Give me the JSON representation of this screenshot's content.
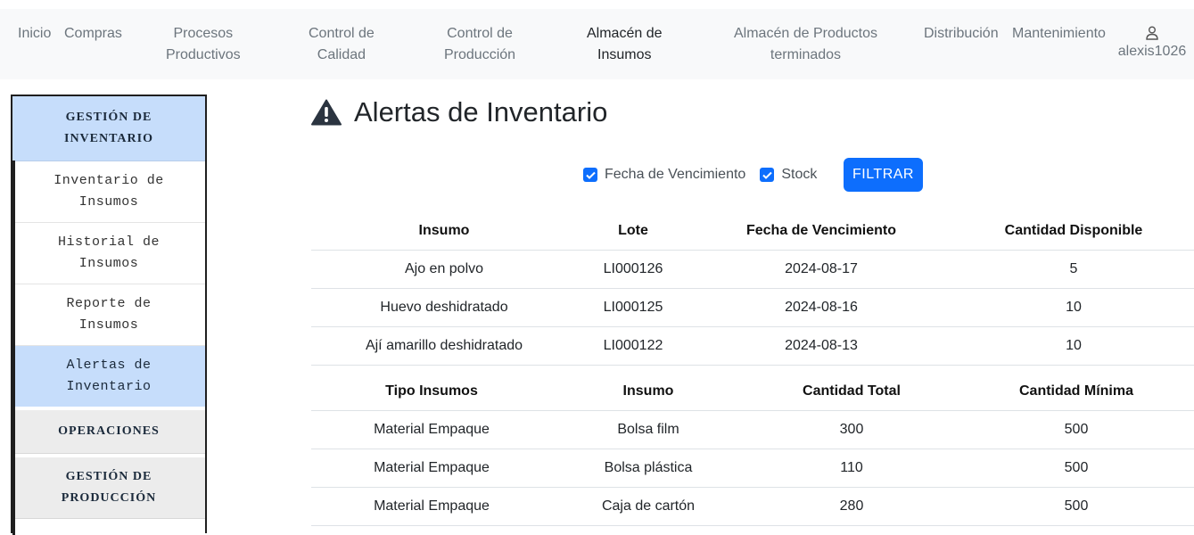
{
  "nav": {
    "items": [
      {
        "label_l1": "Inicio",
        "label_l2": ""
      },
      {
        "label_l1": "Compras",
        "label_l2": ""
      },
      {
        "label_l1": "Procesos",
        "label_l2": "Productivos"
      },
      {
        "label_l1": "Control de",
        "label_l2": "Calidad"
      },
      {
        "label_l1": "Control de",
        "label_l2": "Producción"
      },
      {
        "label_l1": "Almacén de",
        "label_l2": "Insumos"
      },
      {
        "label_l1": "Almacén de Productos",
        "label_l2": "terminados"
      },
      {
        "label_l1": "Distribución",
        "label_l2": ""
      },
      {
        "label_l1": "Mantenimiento",
        "label_l2": ""
      }
    ],
    "user": "alexis1026"
  },
  "sidebar": {
    "header_l1": "GESTIÓN DE",
    "header_l2": "INVENTARIO",
    "items": [
      {
        "l1": "Inventario de",
        "l2": "Insumos"
      },
      {
        "l1": "Historial de",
        "l2": "Insumos"
      },
      {
        "l1": "Reporte de",
        "l2": "Insumos"
      },
      {
        "l1": "Alertas de",
        "l2": "Inventario"
      }
    ],
    "section_operaciones": "OPERACIONES",
    "section_gestion_l1": "GESTIÓN DE",
    "section_gestion_l2": "PRODUCCIÓN"
  },
  "main": {
    "title": "Alertas de Inventario",
    "filters": {
      "fecha_label": "Fecha de Vencimiento",
      "stock_label": "Stock",
      "button_label": "FILTRAR"
    },
    "expiry_table": {
      "headers": [
        "Insumo",
        "Lote",
        "Fecha de Vencimiento",
        "Cantidad Disponible"
      ],
      "rows": [
        [
          "Ajo en polvo",
          "LI000126",
          "2024-08-17",
          "5"
        ],
        [
          "Huevo deshidratado",
          "LI000125",
          "2024-08-16",
          "10"
        ],
        [
          "Ají amarillo deshidratado",
          "LI000122",
          "2024-08-13",
          "10"
        ]
      ]
    },
    "stock_table": {
      "headers": [
        "Tipo Insumos",
        "Insumo",
        "Cantidad Total",
        "Cantidad Mínima"
      ],
      "rows": [
        [
          "Material Empaque",
          "Bolsa film",
          "300",
          "500"
        ],
        [
          "Material Empaque",
          "Bolsa plástica",
          "110",
          "500"
        ],
        [
          "Material Empaque",
          "Caja de cartón",
          "280",
          "500"
        ]
      ]
    }
  },
  "colors": {
    "primary": "#0d6efd",
    "sidebar_active": "#c6ddfb",
    "nav_bg": "#f8f9fa"
  }
}
